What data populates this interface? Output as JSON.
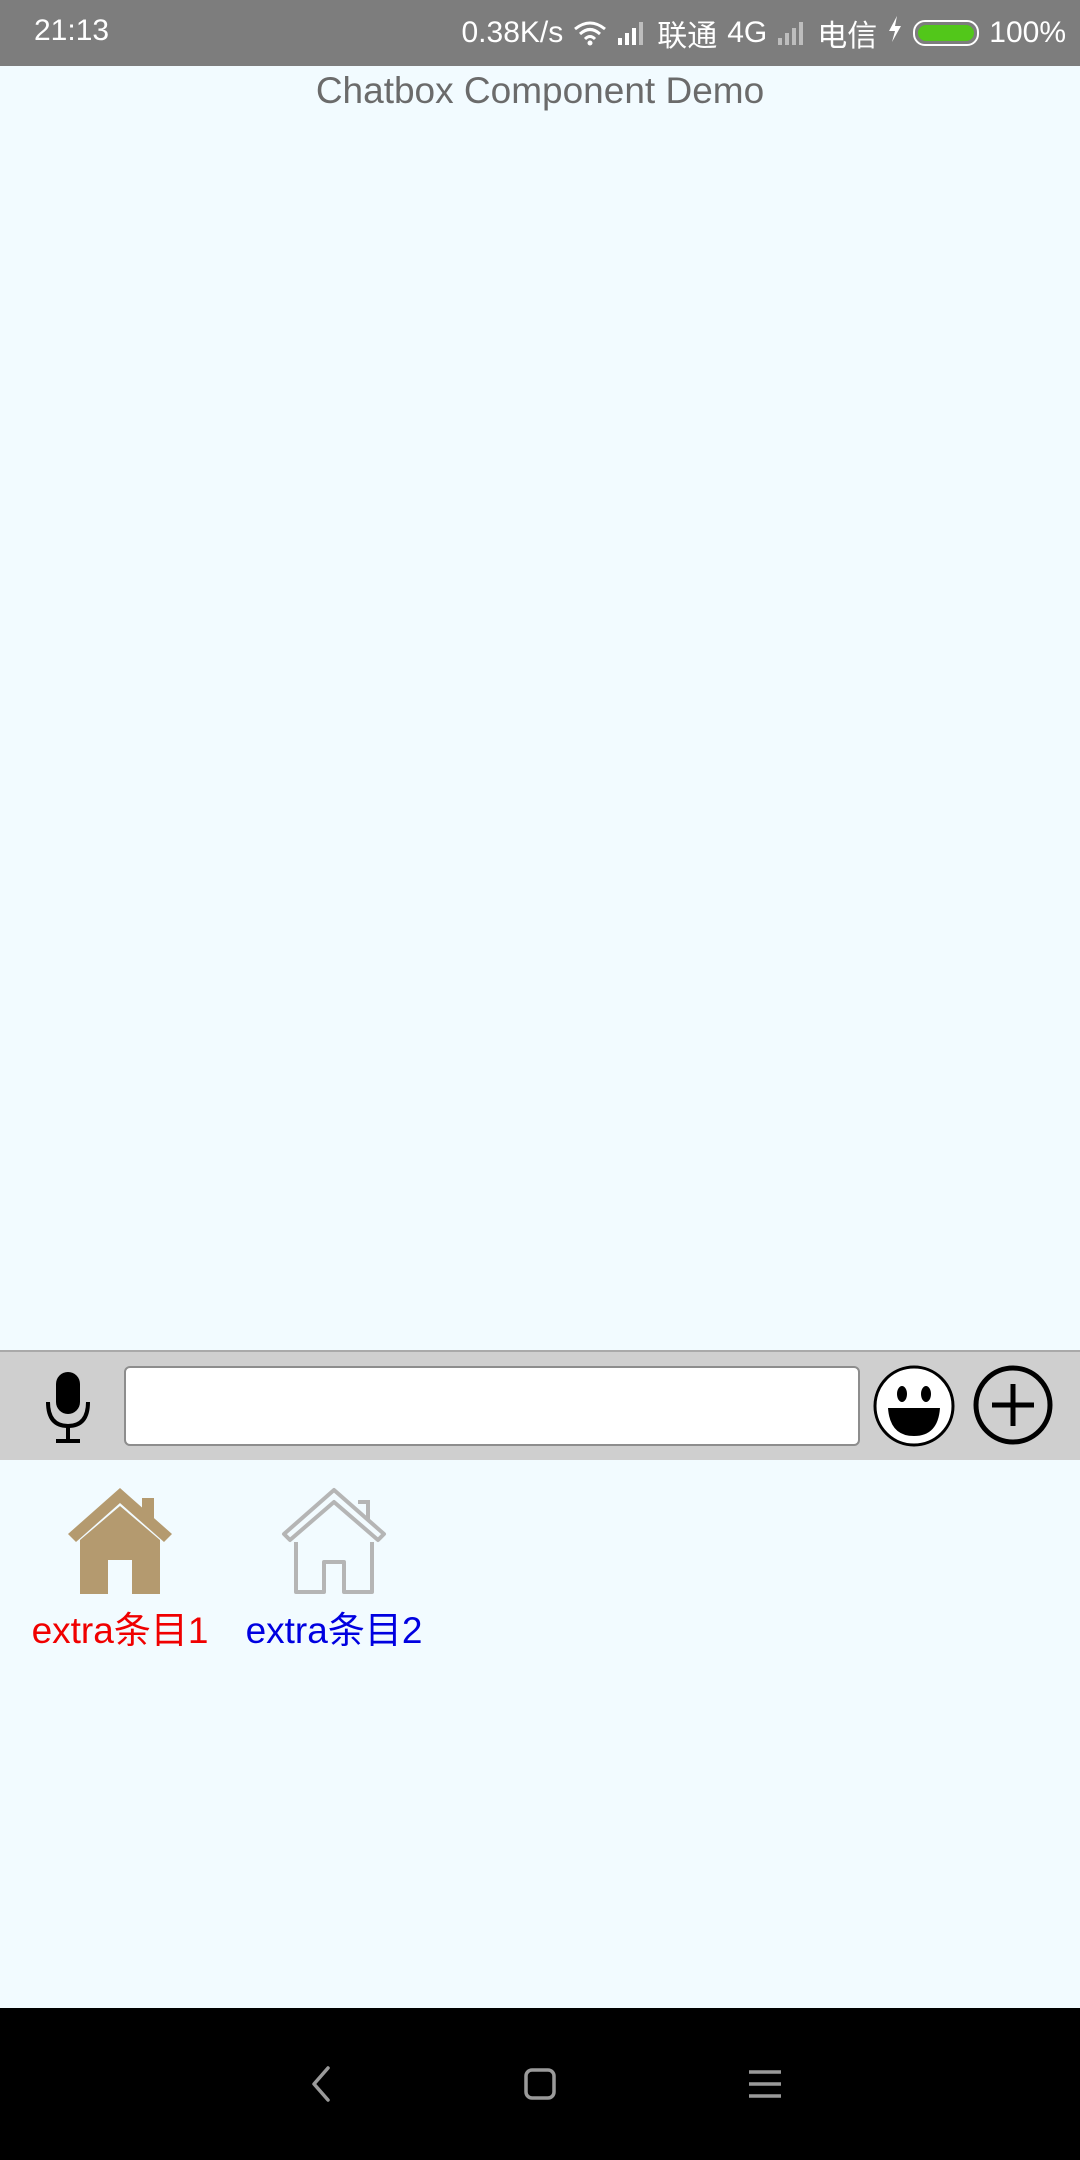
{
  "status_bar": {
    "time": "21:13",
    "network_speed": "0.38K/s",
    "carrier1": "联通",
    "network_type": "4G",
    "carrier2": "电信",
    "battery": "100%",
    "battery_color": "#52c71a"
  },
  "header": {
    "title": "Chatbox Component Demo"
  },
  "input_bar": {
    "voice_icon": "microphone-icon",
    "text_value": "",
    "emoji_icon": "smiley-icon",
    "more_icon": "plus-circle-icon"
  },
  "extra_panel": {
    "items": [
      {
        "label": "extra条目1",
        "icon": "house-filled-icon",
        "color": "#f00000"
      },
      {
        "label": "extra条目2",
        "icon": "house-outline-icon",
        "color": "#0000e0"
      }
    ]
  },
  "nav_bar": {
    "back_icon": "back-icon",
    "home_icon": "home-icon",
    "menu_icon": "menu-icon"
  }
}
